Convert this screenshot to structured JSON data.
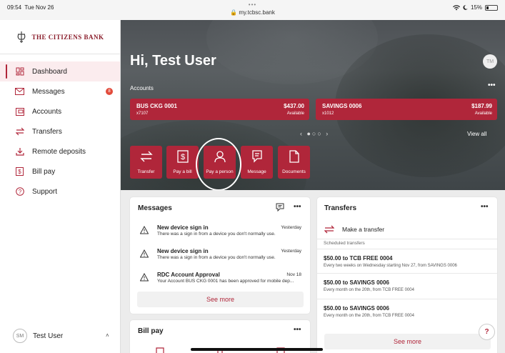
{
  "status_bar": {
    "time": "09:54",
    "date": "Tue Nov 26",
    "url": "my.tcbsc.bank",
    "battery": "15%",
    "dots": "•••"
  },
  "brand": {
    "name": "The Citizens Bank"
  },
  "nav": [
    {
      "label": "Dashboard",
      "icon": "dashboard-icon",
      "active": true
    },
    {
      "label": "Messages",
      "icon": "mail-icon",
      "badge": "8"
    },
    {
      "label": "Accounts",
      "icon": "accounts-icon"
    },
    {
      "label": "Transfers",
      "icon": "transfer-icon"
    },
    {
      "label": "Remote deposits",
      "icon": "deposit-icon"
    },
    {
      "label": "Bill pay",
      "icon": "bill-icon"
    },
    {
      "label": "Support",
      "icon": "help-icon"
    }
  ],
  "user": {
    "initials": "SM",
    "name": "Test User",
    "caret": "˄"
  },
  "hero": {
    "greeting": "Hi, Test User",
    "avatar_initials": "TM",
    "accounts_label": "Accounts",
    "more": "•••",
    "accounts": [
      {
        "name": "BUS CKG 0001",
        "id": "x7107",
        "balance": "$437.00",
        "balance_label": "Available"
      },
      {
        "name": "SAVINGS 0006",
        "id": "x1012",
        "balance": "$187.99",
        "balance_label": "Available"
      }
    ],
    "pager": "‹ ●○○ ›",
    "view_all": "View all",
    "quick_actions": [
      {
        "label": "Transfer",
        "icon": "transfer-icon"
      },
      {
        "label": "Pay a bill",
        "icon": "bill-icon"
      },
      {
        "label": "Pay a person",
        "icon": "person-icon"
      },
      {
        "label": "Message",
        "icon": "message-icon"
      },
      {
        "label": "Documents",
        "icon": "document-icon"
      }
    ]
  },
  "messages_card": {
    "title": "Messages",
    "more": "•••",
    "items": [
      {
        "title": "New device sign in",
        "desc": "There was a sign in from a device you don't normally use.",
        "date": "Yesterday"
      },
      {
        "title": "New device sign in",
        "desc": "There was a sign in from a device you don't normally use.",
        "date": "Yesterday"
      },
      {
        "title": "RDC Account Approval",
        "desc": "Your Account BUS CKG 0001 has been approved for mobile dep...",
        "date": "Nov 18"
      }
    ],
    "see_more": "See more"
  },
  "billpay_card": {
    "title": "Bill pay",
    "more": "•••"
  },
  "transfers_card": {
    "title": "Transfers",
    "more": "•••",
    "make_transfer": "Make a transfer",
    "scheduled_label": "Scheduled transfers",
    "items": [
      {
        "title": "$50.00 to TCB FREE 0004",
        "desc": "Every two weeks on Wednesday starting Nov 27, from SAVINGS 0006"
      },
      {
        "title": "$50.00 to SAVINGS 0006",
        "desc": "Every month on the 20th, from TCB FREE 0004"
      },
      {
        "title": "$50.00 to SAVINGS 0006",
        "desc": "Every month on the 20th, from TCB FREE 0004"
      }
    ],
    "see_more": "See more"
  },
  "help_button": "?",
  "colors": {
    "brand": "#b0263a",
    "badge": "#e24b3b"
  }
}
